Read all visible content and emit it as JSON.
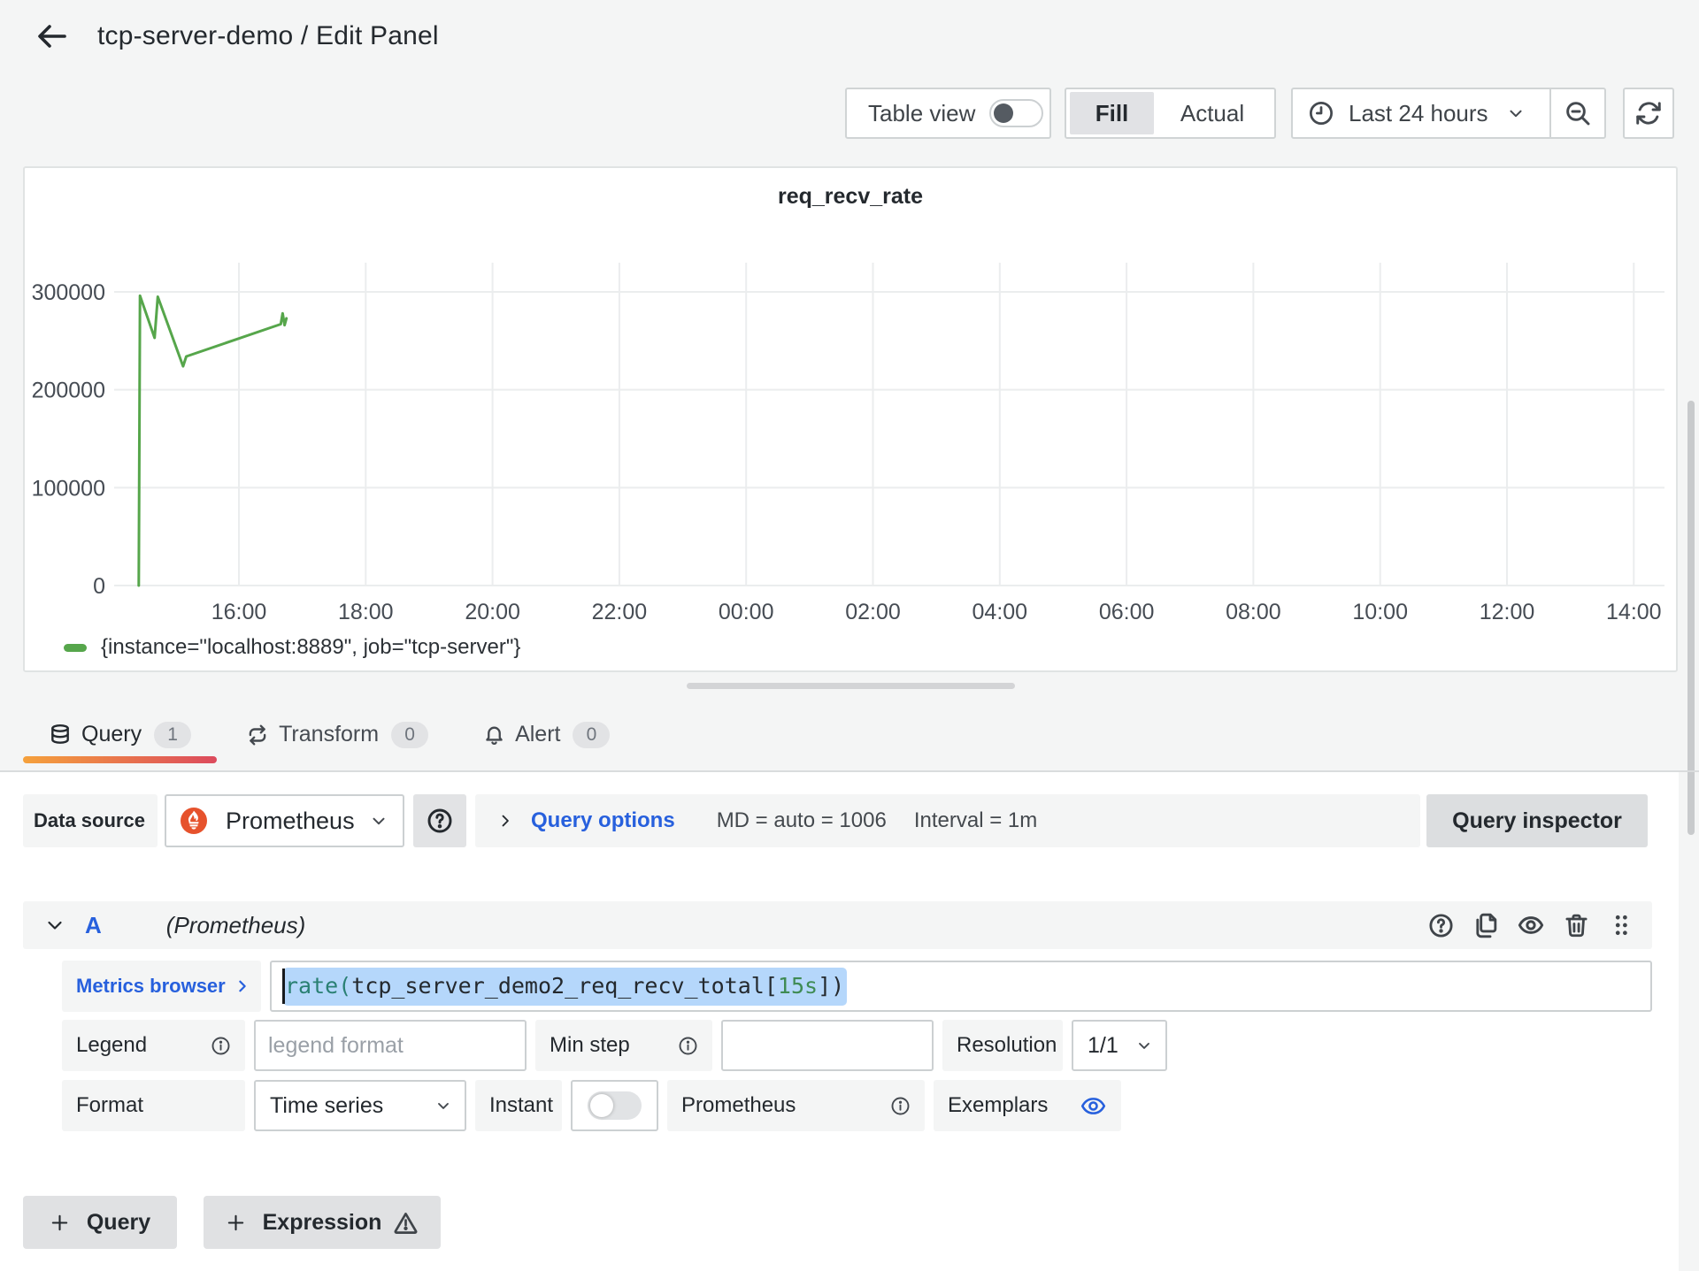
{
  "header": {
    "title": "tcp-server-demo / Edit Panel"
  },
  "toolbar": {
    "table_view_label": "Table view",
    "table_view_enabled": false,
    "display_modes": {
      "fill": "Fill",
      "actual": "Actual"
    },
    "selected_display_mode": "Fill",
    "time_range": "Last 24 hours"
  },
  "chart_data": {
    "type": "line",
    "title": "req_recv_rate",
    "xlabel": "",
    "ylabel": "",
    "x_ticks": [
      "16:00",
      "18:00",
      "20:00",
      "22:00",
      "00:00",
      "02:00",
      "04:00",
      "06:00",
      "08:00",
      "10:00",
      "12:00",
      "14:00"
    ],
    "x_tick_hours": [
      16,
      18,
      20,
      22,
      24,
      26,
      28,
      30,
      32,
      34,
      36,
      38
    ],
    "x_range_hours": [
      14.03,
      38.48
    ],
    "y_ticks": [
      0,
      100000,
      200000,
      300000
    ],
    "ylim": [
      0,
      329800
    ],
    "grid": true,
    "legend_position": "bottom-left",
    "series": [
      {
        "name": "{instance=\"localhost:8889\", job=\"tcp-server\"}",
        "color": "#56a64b",
        "points": [
          [
            14.42,
            0
          ],
          [
            14.44,
            296000
          ],
          [
            14.67,
            253000
          ],
          [
            14.72,
            295000
          ],
          [
            15.12,
            224000
          ],
          [
            15.17,
            234000
          ],
          [
            16.66,
            267000
          ],
          [
            16.69,
            278000
          ],
          [
            16.72,
            266000
          ],
          [
            16.75,
            273000
          ]
        ]
      }
    ]
  },
  "tabs": [
    {
      "label": "Query",
      "count": "1",
      "active": true
    },
    {
      "label": "Transform",
      "count": "0",
      "active": false
    },
    {
      "label": "Alert",
      "count": "0",
      "active": false
    }
  ],
  "datasource_bar": {
    "label": "Data source",
    "value": "Prometheus",
    "query_options_label": "Query options",
    "max_data_points": "MD = auto = 1006",
    "interval": "Interval = 1m",
    "query_inspector_label": "Query inspector"
  },
  "query_editor": {
    "ref_id": "A",
    "datasource_hint": "(Prometheus)",
    "metrics_browser_label": "Metrics browser",
    "expression_parts": [
      {
        "text": "rate(",
        "token": "function"
      },
      {
        "text": "tcp_server_demo2_req_recv_total",
        "token": "metric"
      },
      {
        "text": "[",
        "token": "punctuation"
      },
      {
        "text": "15s",
        "token": "duration"
      },
      {
        "text": "])",
        "token": "punctuation"
      }
    ],
    "expression_selected": true,
    "legend_label": "Legend",
    "legend_placeholder": "legend format",
    "min_step_label": "Min step",
    "min_step_value": "",
    "resolution_label": "Resolution",
    "resolution_value": "1/1",
    "format_label": "Format",
    "format_value": "Time series",
    "instant_label": "Instant",
    "instant_enabled": false,
    "prometheus_label": "Prometheus",
    "exemplars_label": "Exemplars"
  },
  "footer_actions": {
    "add_query": "Query",
    "add_expression": "Expression"
  },
  "colors": {
    "accent_blue": "#2760dd",
    "series_green": "#56a64b",
    "tab_gradient_start": "#f5a13c",
    "tab_gradient_end": "#dc4a5d",
    "prometheus_orange": "#e6522c",
    "selection_blue": "#b5d7fb",
    "page_background": "#f4f5f5"
  }
}
